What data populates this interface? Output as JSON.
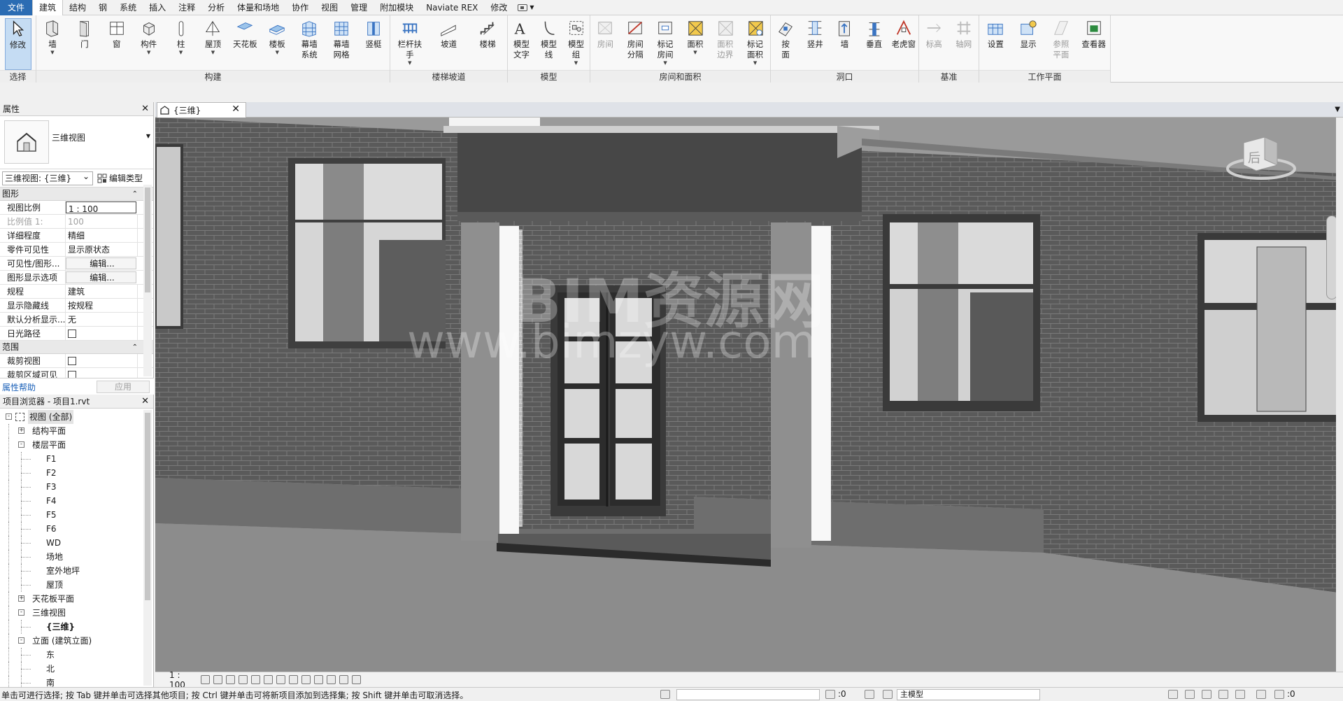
{
  "menu": {
    "tabs": [
      "文件",
      "建筑",
      "结构",
      "钢",
      "系统",
      "插入",
      "注释",
      "分析",
      "体量和场地",
      "协作",
      "视图",
      "管理",
      "附加模块",
      "Naviate REX",
      "修改"
    ],
    "active_index": 1
  },
  "ribbon": {
    "select_panel": {
      "title": "选择",
      "buttons": [
        {
          "label": "修改",
          "icon": "cursor-icon"
        }
      ]
    },
    "build_panel": {
      "title": "构建",
      "buttons": [
        {
          "label": "墙",
          "icon": "wall-icon",
          "dd": true
        },
        {
          "label": "门",
          "icon": "door-icon"
        },
        {
          "label": "窗",
          "icon": "window-icon"
        },
        {
          "label": "构件",
          "icon": "component-icon",
          "dd": true
        },
        {
          "label": "柱",
          "icon": "column-icon",
          "dd": true
        },
        {
          "label": "屋顶",
          "icon": "roof-icon",
          "dd": true
        },
        {
          "label": "天花板",
          "icon": "ceiling-icon"
        },
        {
          "label": "楼板",
          "icon": "floor-icon",
          "dd": true
        },
        {
          "label": "幕墙\n系统",
          "icon": "curtain-system-icon"
        },
        {
          "label": "幕墙\n网格",
          "icon": "curtain-grid-icon"
        },
        {
          "label": "竖梃",
          "icon": "mullion-icon"
        }
      ]
    },
    "circ_panel": {
      "title": "楼梯坡道",
      "buttons": [
        {
          "label": "栏杆扶手",
          "icon": "railing-icon",
          "dd": true
        },
        {
          "label": "坡道",
          "icon": "ramp-icon"
        },
        {
          "label": "楼梯",
          "icon": "stair-icon"
        }
      ]
    },
    "model_panel": {
      "title": "模型",
      "buttons": [
        {
          "label": "模型\n文字",
          "icon": "model-text-icon"
        },
        {
          "label": "模型\n线",
          "icon": "model-line-icon"
        },
        {
          "label": "模型\n组",
          "icon": "model-group-icon",
          "dd": true
        }
      ]
    },
    "room_panel": {
      "title": "房间和面积",
      "buttons": [
        {
          "label": "房间",
          "icon": "room-icon",
          "dis": true
        },
        {
          "label": "房间\n分隔",
          "icon": "room-separator-icon"
        },
        {
          "label": "标记\n房间",
          "icon": "tag-room-icon",
          "dd": true
        },
        {
          "label": "面积",
          "icon": "area-icon",
          "dd": true
        },
        {
          "label": "面积\n边界",
          "icon": "area-boundary-icon",
          "dis": true
        },
        {
          "label": "标记\n面积",
          "icon": "tag-area-icon",
          "dd": true
        }
      ]
    },
    "opening_panel": {
      "title": "洞口",
      "buttons": [
        {
          "label": "按\n面",
          "icon": "by-face-icon"
        },
        {
          "label": "竖井",
          "icon": "shaft-icon"
        },
        {
          "label": "墙",
          "icon": "wall-opening-icon"
        },
        {
          "label": "垂直",
          "icon": "vertical-icon"
        },
        {
          "label": "老虎窗",
          "icon": "dormer-icon"
        }
      ]
    },
    "datum_panel": {
      "title": "基准",
      "buttons": [
        {
          "label": "标高",
          "icon": "level-icon",
          "dis": true
        },
        {
          "label": "轴网",
          "icon": "grid-icon",
          "dis": true
        }
      ]
    },
    "workplane_panel": {
      "title": "工作平面",
      "buttons": [
        {
          "label": "设置",
          "icon": "set-icon"
        },
        {
          "label": "显示",
          "icon": "show-icon"
        },
        {
          "label": "参照\n平面",
          "icon": "ref-plane-icon",
          "dis": true
        },
        {
          "label": "查看器",
          "icon": "viewer-icon"
        }
      ]
    }
  },
  "properties": {
    "title": "属性",
    "type_name": "三维视图",
    "instance_selector": "三维视图: {三维}",
    "edit_type": "编辑类型",
    "graphics_group": "图形",
    "rows": [
      {
        "k": "视图比例",
        "v": "1 : 100",
        "style": "box"
      },
      {
        "k": "比例值 1:",
        "v": "100",
        "dis": true
      },
      {
        "k": "详细程度",
        "v": "精细"
      },
      {
        "k": "零件可见性",
        "v": "显示原状态"
      },
      {
        "k": "可见性/图形...",
        "v": "编辑...",
        "style": "btn"
      },
      {
        "k": "图形显示选项",
        "v": "编辑...",
        "style": "btn"
      },
      {
        "k": "规程",
        "v": "建筑"
      },
      {
        "k": "显示隐藏线",
        "v": "按规程"
      },
      {
        "k": "默认分析显示...",
        "v": "无"
      },
      {
        "k": "日光路径",
        "v": "",
        "style": "check"
      }
    ],
    "extents_group": "范围",
    "rows2": [
      {
        "k": "裁剪视图",
        "v": "",
        "style": "check"
      },
      {
        "k": "裁剪区域可见",
        "v": "",
        "style": "check"
      }
    ],
    "help_link": "属性帮助",
    "apply_label": "应用"
  },
  "browser": {
    "title": "项目浏览器 - 项目1.rvt",
    "nodes": [
      {
        "label": "视图 (全部)",
        "level": 0,
        "exp": "-",
        "hl": true
      },
      {
        "label": "结构平面",
        "level": 1,
        "exp": "+"
      },
      {
        "label": "楼层平面",
        "level": 1,
        "exp": "-"
      },
      {
        "label": "F1",
        "level": 2
      },
      {
        "label": "F2",
        "level": 2
      },
      {
        "label": "F3",
        "level": 2
      },
      {
        "label": "F4",
        "level": 2
      },
      {
        "label": "F5",
        "level": 2
      },
      {
        "label": "F6",
        "level": 2
      },
      {
        "label": "WD",
        "level": 2
      },
      {
        "label": "场地",
        "level": 2
      },
      {
        "label": "室外地坪",
        "level": 2
      },
      {
        "label": "屋顶",
        "level": 2
      },
      {
        "label": "天花板平面",
        "level": 1,
        "exp": "+"
      },
      {
        "label": "三维视图",
        "level": 1,
        "exp": "-"
      },
      {
        "label": "{三维}",
        "level": 2,
        "bold": true
      },
      {
        "label": "立面 (建筑立面)",
        "level": 1,
        "exp": "-"
      },
      {
        "label": "东",
        "level": 2
      },
      {
        "label": "北",
        "level": 2
      },
      {
        "label": "南",
        "level": 2
      }
    ]
  },
  "view": {
    "tab_label": "{三维}",
    "watermark_line1": "BIM资源网",
    "watermark_line2": "www.bimzyw.com",
    "viewcube_face": "后"
  },
  "view_control": {
    "scale": "1 : 100"
  },
  "status": {
    "message": "单击可进行选择; 按 Tab 键并单击可选择其他项目; 按 Ctrl 键并单击可将新项目添加到选择集; 按 Shift 键并单击可取消选择。",
    "count": ":0",
    "model": "主模型",
    "filter": ":0"
  },
  "colors": {
    "accent": "#2b6cb3",
    "ribbon_bg": "#f8f8f8",
    "wall": "#5c5c5c",
    "canopy": "#4a4a4a"
  }
}
